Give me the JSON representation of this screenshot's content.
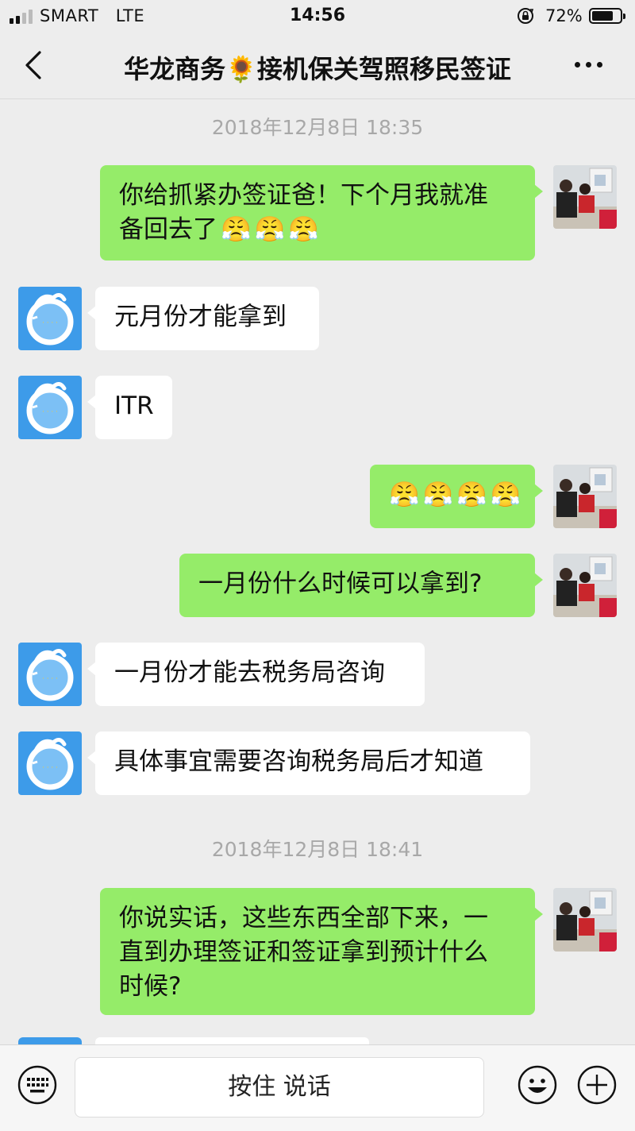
{
  "status_bar": {
    "carrier": "SMART",
    "network": "LTE",
    "time": "14:56",
    "battery_percent": "72%",
    "battery_level": 0.72,
    "signal_bars_filled": 2,
    "signal_bars_total": 4
  },
  "nav": {
    "back_icon": "chevron-left-icon",
    "title_prefix": "华龙商务",
    "title_emoji": "🌻",
    "title_suffix": "接机保关驾照移民签证",
    "more_icon": "more-dots-icon"
  },
  "messages": [
    {
      "type": "timestamp",
      "text": "2018年12月8日 18:35"
    },
    {
      "type": "message",
      "side": "right",
      "line1": "你给抓紧办签证爸！下个月我就准",
      "line2": "备回去了",
      "emoji": [
        "😤",
        "😤",
        "😤"
      ]
    },
    {
      "type": "message",
      "side": "left",
      "text": "元月份才能拿到"
    },
    {
      "type": "message",
      "side": "left",
      "text": "ITR"
    },
    {
      "type": "message",
      "side": "right",
      "emoji": [
        "😤",
        "😤",
        "😤",
        "😤"
      ]
    },
    {
      "type": "message",
      "side": "right",
      "text": "一月份什么时候可以拿到?"
    },
    {
      "type": "message",
      "side": "left",
      "text": "一月份才能去税务局咨询"
    },
    {
      "type": "message",
      "side": "left",
      "text": "具体事宜需要咨询税务局后才知道"
    },
    {
      "type": "timestamp",
      "text": "2018年12月8日 18:41"
    },
    {
      "type": "message",
      "side": "right",
      "line1": "你说实话，这些东西全部下来，一",
      "line2": "直到办理签证和签证拿到预计什么",
      "line3": "时候?"
    }
  ],
  "input_bar": {
    "voice_label": "按住 说话",
    "keyboard_icon": "keyboard-icon",
    "emoji_icon": "smiley-icon",
    "plus_icon": "plus-circle-icon"
  },
  "colors": {
    "background": "#ededed",
    "outgoing_bubble": "#95ec69",
    "incoming_bubble": "#ffffff",
    "timestamp_text": "#a8a8a8",
    "contact_avatar_blue": "#3d9be9"
  }
}
